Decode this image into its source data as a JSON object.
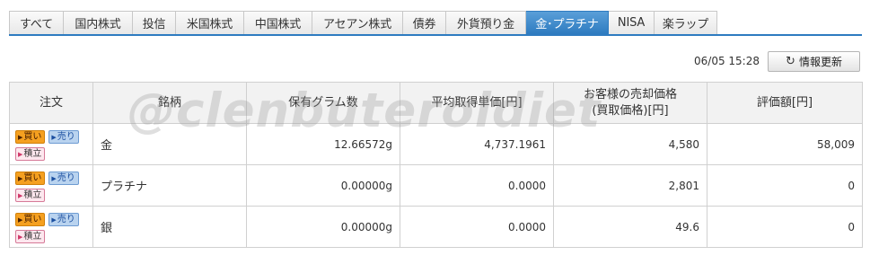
{
  "tabs": [
    "すべて",
    "国内株式",
    "投信",
    "米国株式",
    "中国株式",
    "アセアン株式",
    "債券",
    "外貨預り金",
    "金･プラチナ",
    "NISA",
    "楽ラップ"
  ],
  "active_tab": "金･プラチナ",
  "timestamp": "06/05 15:28",
  "refresh_label": "情報更新",
  "headers": {
    "order": "注文",
    "name": "銘柄",
    "grams": "保有グラム数",
    "avg_price": "平均取得単価[円]",
    "sell_price_1": "お客様の売却価格",
    "sell_price_2": "(買取価格)[円]",
    "value": "評価額[円]"
  },
  "buttons": {
    "buy": "買い",
    "sell": "売り",
    "save": "積立"
  },
  "rows": [
    {
      "name": "金",
      "grams": "12.66572g",
      "avg_price": "4,737.1961",
      "sell_price": "4,580",
      "value": "58,009"
    },
    {
      "name": "プラチナ",
      "grams": "0.00000g",
      "avg_price": "0.0000",
      "sell_price": "2,801",
      "value": "0"
    },
    {
      "name": "銀",
      "grams": "0.00000g",
      "avg_price": "0.0000",
      "sell_price": "49.6",
      "value": "0"
    }
  ],
  "watermark": "@clenbuteroldiet"
}
